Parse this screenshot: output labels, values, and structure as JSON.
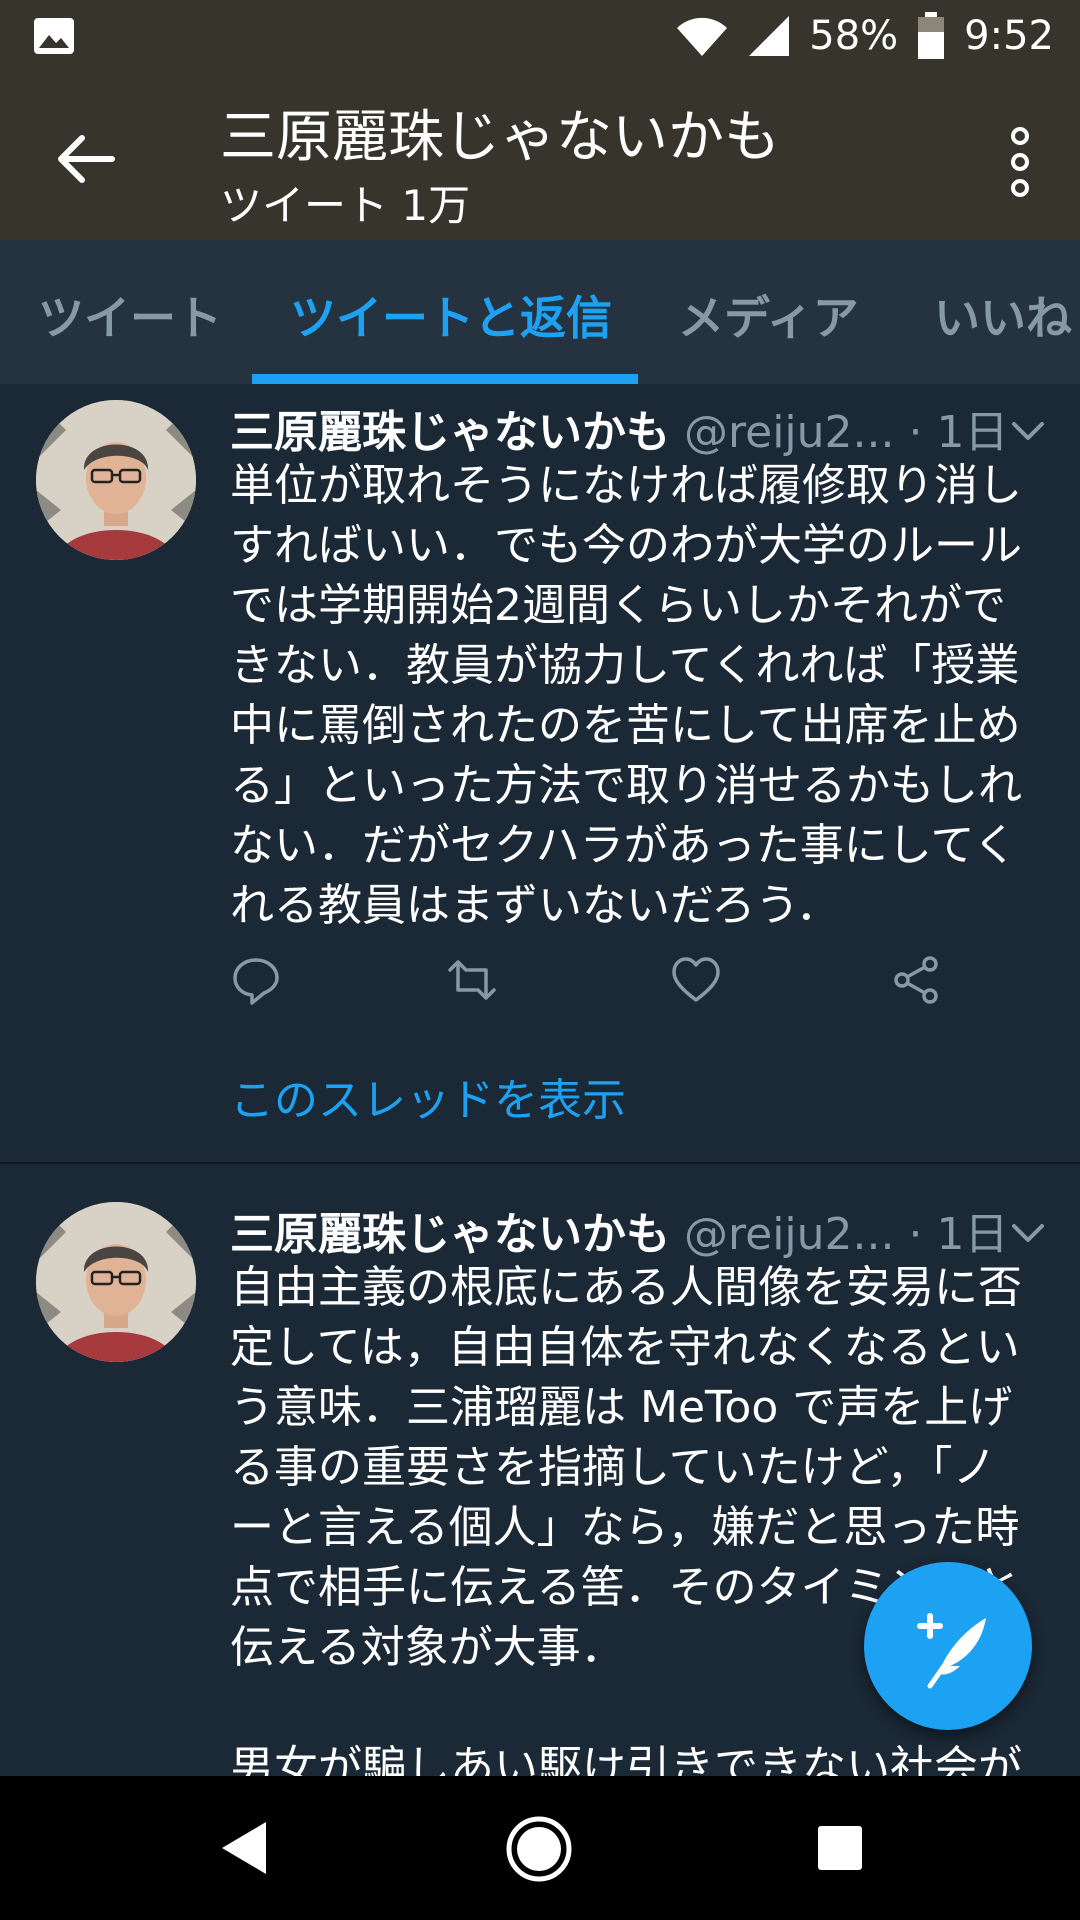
{
  "status_bar": {
    "battery": "58%",
    "time": "9:52"
  },
  "header": {
    "title": "三原麗珠じゃないかも",
    "subtitle": "ツイート 1万"
  },
  "tabs": [
    {
      "label": "ツイート",
      "active": false
    },
    {
      "label": "ツイートと返信",
      "active": true
    },
    {
      "label": "メディア",
      "active": false
    },
    {
      "label": "いいね",
      "active": false
    }
  ],
  "tweets": [
    {
      "name": "三原麗珠じゃないかも",
      "handle": "@reiju2...",
      "time": " · 1日",
      "text": "単位が取れそうになければ履修取り消し\nすればいい．でも今のわが大学のルール\nでは学期開始2週間くらいしかそれがで\nきない．教員が協力してくれれば「授業\n中に罵倒されたのを苦にして出席を止め\nる」といった方法で取り消せるかもしれ\nない．だがセクハラがあった事にしてく\nれる教員はまずいないだろう．",
      "thread_link": "このスレッドを表示"
    },
    {
      "name": "三原麗珠じゃないかも",
      "handle": "@reiju2...",
      "time": " · 1日",
      "text": "自由主義の根底にある人間像を安易に否\n定しては，自由自体を守れなくなるとい\nう意味．三浦瑠麗は MeToo で声を上げ\nる事の重要さを指摘していたけど，「ノ\nーと言える個人」なら，嫌だと思った時\n点で相手に伝える筈．そのタイミングと\n伝える対象が大事．\n\n男女が騙しあい駆け引きできない社会が"
    }
  ],
  "colors": {
    "accent": "#1da1f2",
    "background": "#1b2836",
    "header": "#36342b",
    "tab_bar": "#253341",
    "muted": "#8899a6"
  },
  "icons": {
    "status": [
      "gallery-icon",
      "wifi-icon",
      "signal-icon",
      "battery-icon"
    ],
    "header": [
      "back-arrow-icon",
      "more-vert-icon"
    ],
    "tweet_actions": [
      "reply-icon",
      "retweet-icon",
      "like-icon",
      "share-icon"
    ],
    "fab": "compose-tweet-icon",
    "nav": [
      "nav-back-icon",
      "nav-home-icon",
      "nav-recents-icon"
    ]
  }
}
